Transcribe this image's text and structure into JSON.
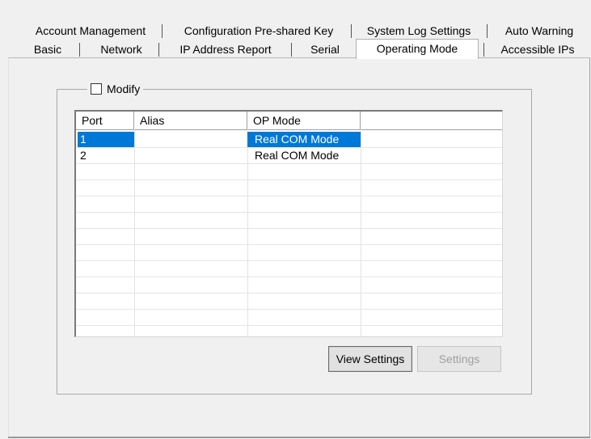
{
  "tabs_row1": [
    {
      "label": "Account Management"
    },
    {
      "label": "Configuration Pre-shared Key"
    },
    {
      "label": "System Log Settings"
    },
    {
      "label": "Auto Warning"
    }
  ],
  "tabs_row2": [
    {
      "label": "Basic"
    },
    {
      "label": "Network"
    },
    {
      "label": "IP Address Report"
    },
    {
      "label": "Serial"
    },
    {
      "label": "Operating Mode",
      "active": true
    },
    {
      "label": "Accessible IPs"
    }
  ],
  "group": {
    "modify_label": "Modify",
    "modify_checked": false
  },
  "table": {
    "columns": [
      "Port",
      "Alias",
      "OP Mode",
      ""
    ],
    "rows": [
      {
        "port": "1",
        "alias": "",
        "mode": "Real COM Mode",
        "selected": true
      },
      {
        "port": "2",
        "alias": "",
        "mode": "Real COM Mode",
        "selected": false
      }
    ]
  },
  "buttons": {
    "view_settings": "View Settings",
    "settings": "Settings"
  },
  "colors": {
    "selection": "#0078d7"
  }
}
